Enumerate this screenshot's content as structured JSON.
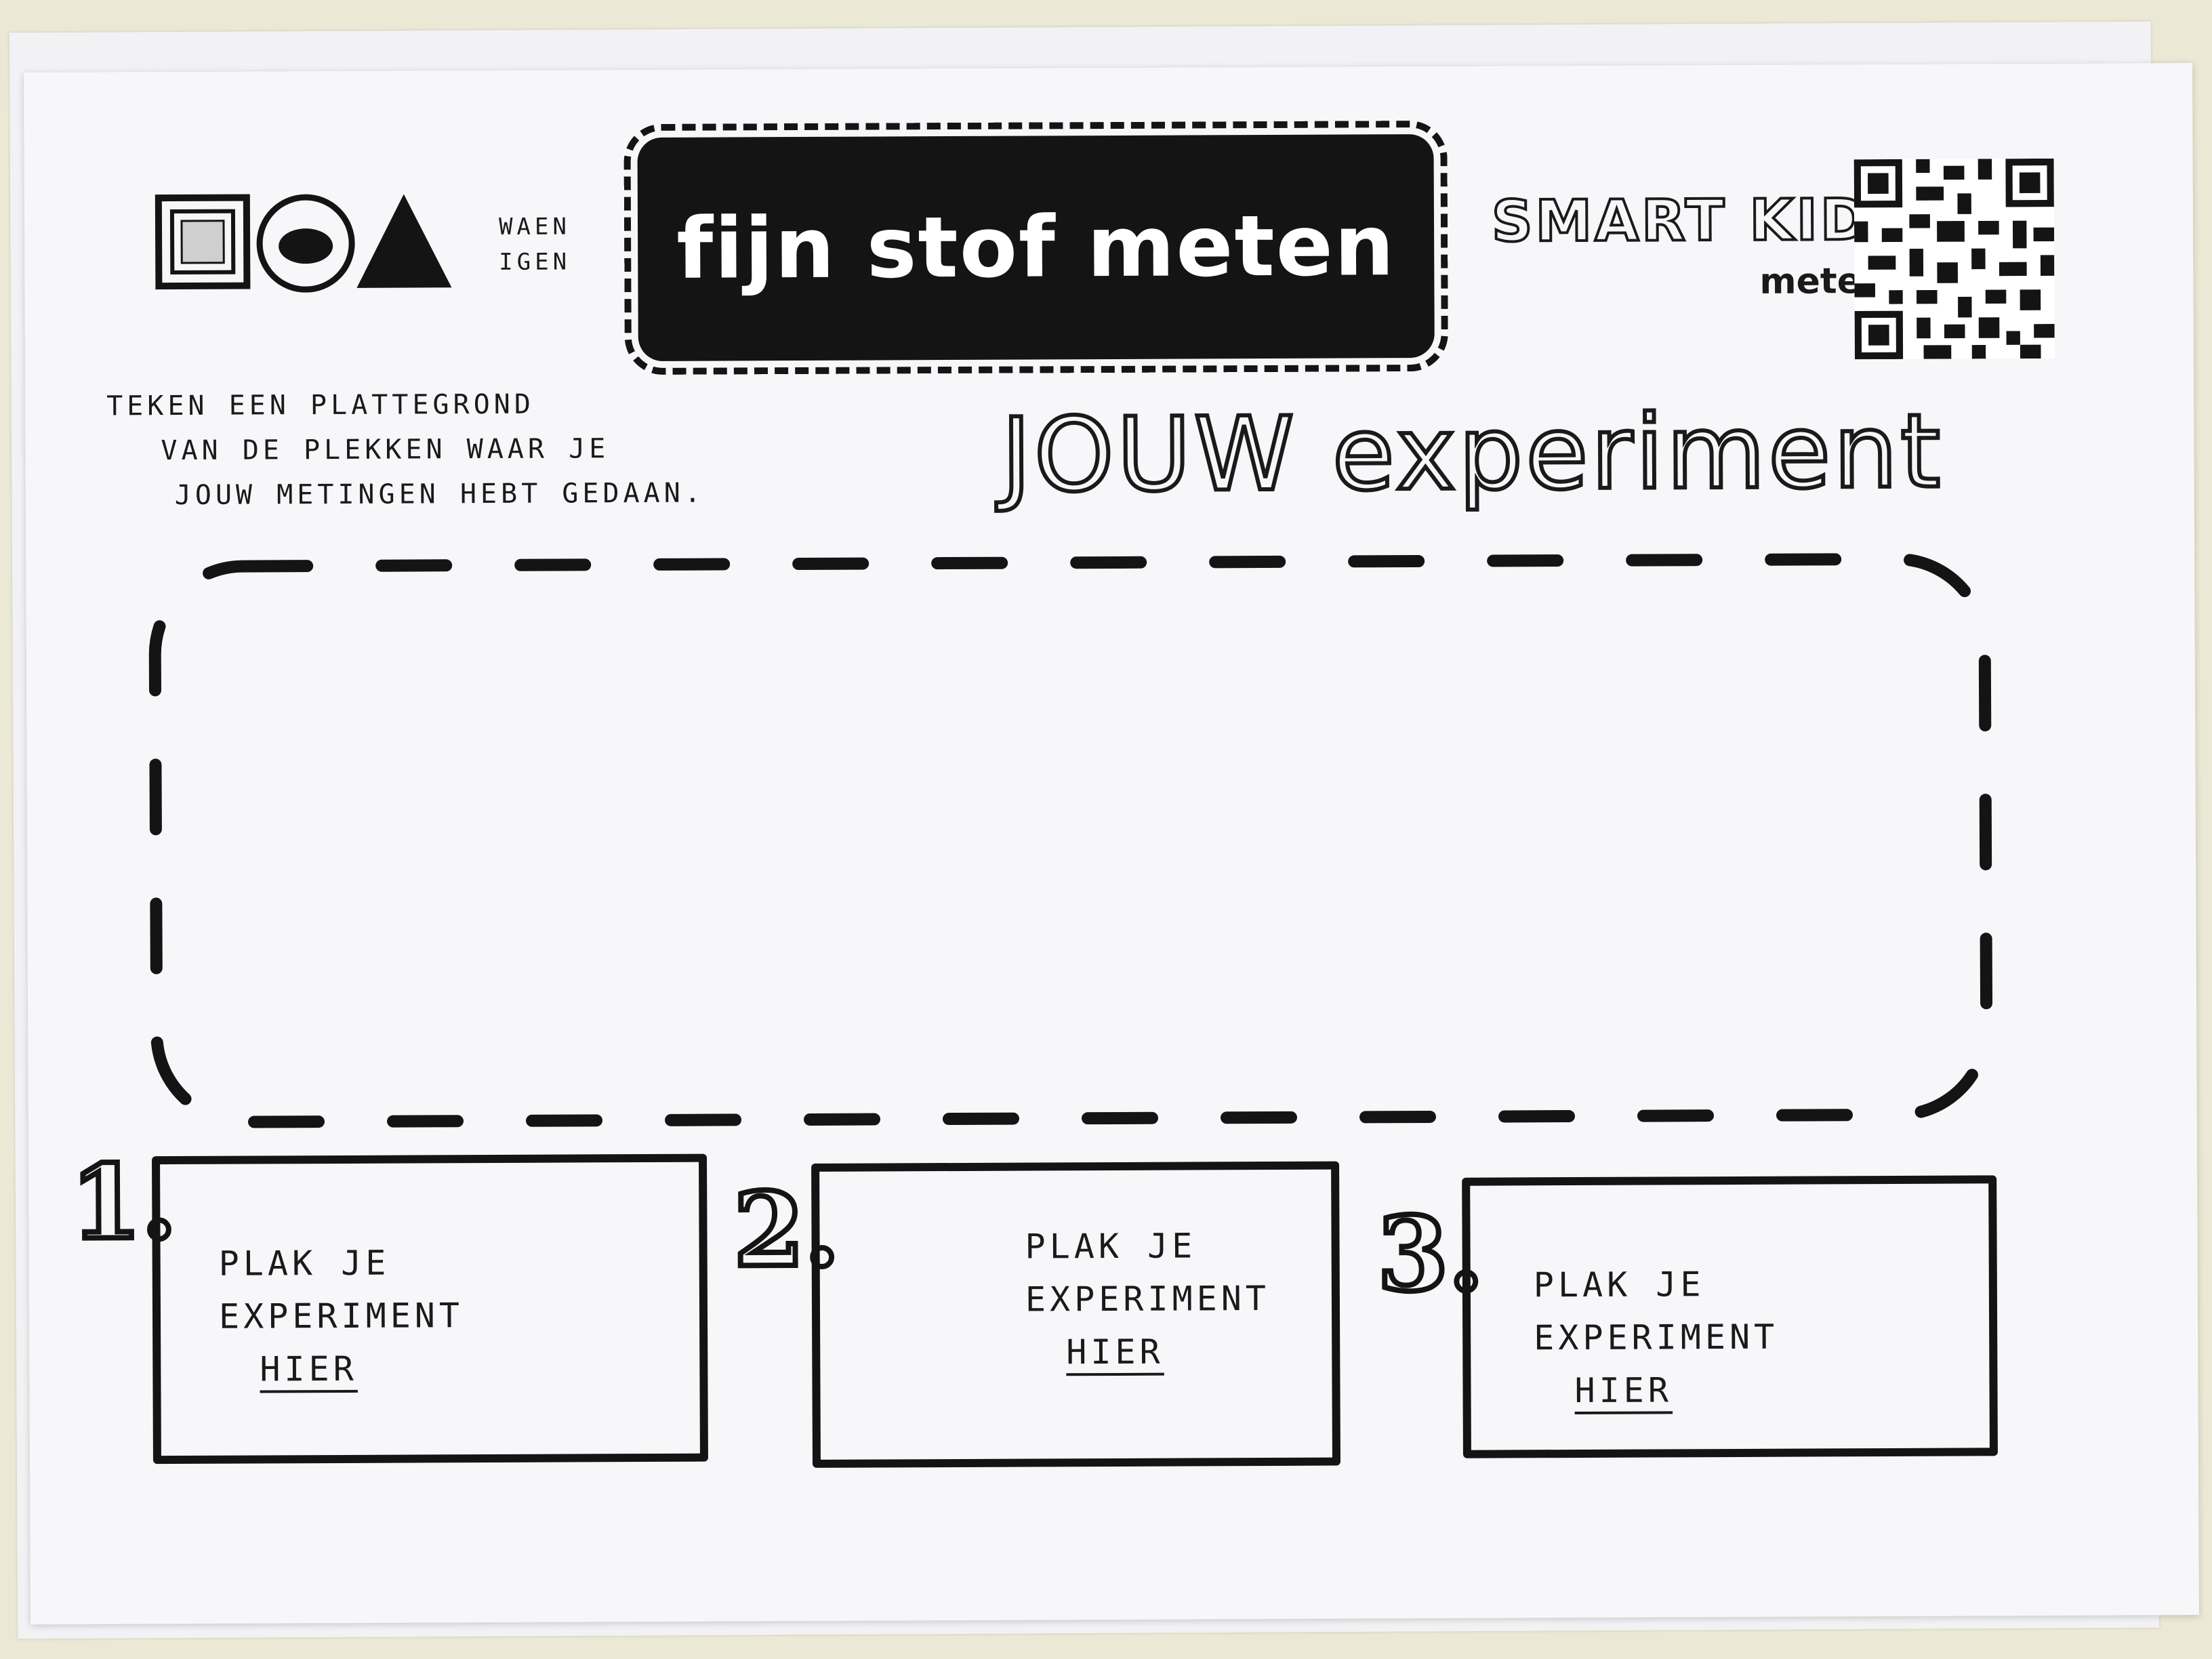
{
  "header": {
    "title": "fijn stof meten",
    "hint_line1": "WAEN",
    "hint_line2": "IGEN",
    "brand": "SMART KIDS",
    "brand_sub": "mete"
  },
  "instruction": {
    "line1": "TEKEN EEN PLATTEGROND",
    "line2": "VAN DE PLEKKEN WAAR JE",
    "line3": "JOUW METINGEN HEBT GEDAAN."
  },
  "subtitle": "JOUW experiment",
  "paste_boxes": [
    {
      "number": "1.",
      "line1": "PLAK JE",
      "line2": "EXPERIMENT",
      "line3": "HIER"
    },
    {
      "number": "2.",
      "line1": "PLAK JE",
      "line2": "EXPERIMENT",
      "line3": "HIER"
    },
    {
      "number": "3.",
      "line1": "PLAK JE",
      "line2": "EXPERIMENT",
      "line3": "HIER"
    }
  ],
  "icons": [
    "square-sensor-icon",
    "circle-particles-icon",
    "triangle-icon",
    "qr-code-icon"
  ],
  "colors": {
    "ink": "#141414",
    "paper": "#f7f7fa",
    "table": "#ece8d6"
  }
}
